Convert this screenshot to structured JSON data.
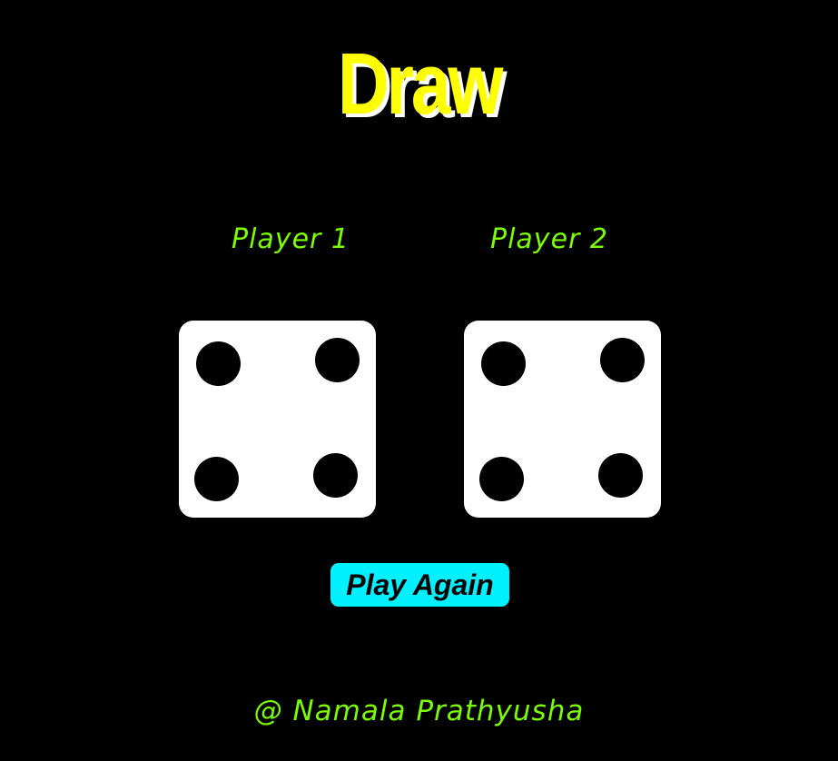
{
  "game": {
    "result_title": "Draw",
    "players": [
      {
        "label": "Player 1",
        "die_value": 4
      },
      {
        "label": "Player 2",
        "die_value": 4
      }
    ],
    "play_again_label": "Play Again",
    "footer": "@ Namala Prathyusha"
  },
  "colors": {
    "background": "#000000",
    "title": "#ffff00",
    "title_shadow": "#ffffff",
    "player_label": "#7cfc00",
    "die_face": "#ffffff",
    "pip": "#000000",
    "button_bg": "#00f0ff",
    "footer": "#7cfc00"
  },
  "icons": {
    "die": "dice-four-icon"
  }
}
